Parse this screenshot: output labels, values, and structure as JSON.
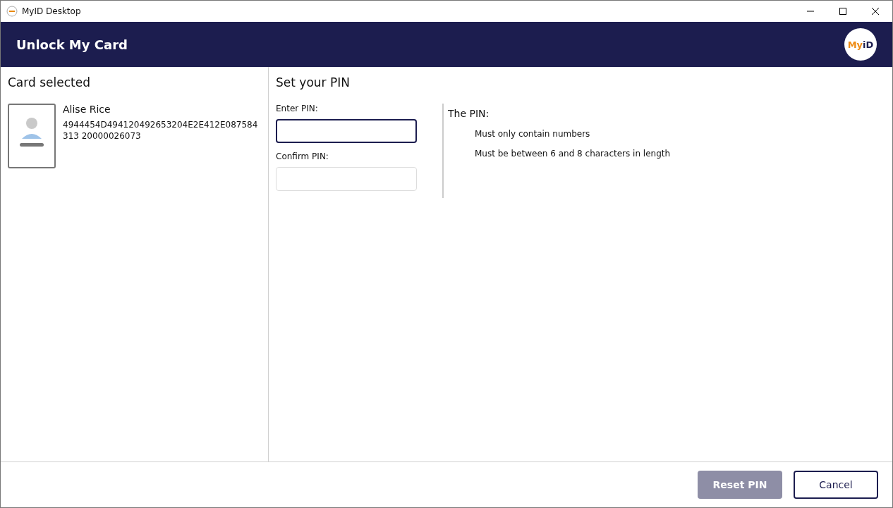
{
  "window": {
    "title": "MyID Desktop"
  },
  "header": {
    "title": "Unlock My Card",
    "logo": {
      "part_1": "My",
      "part_2": "iD"
    }
  },
  "card_panel": {
    "heading": "Card selected",
    "card": {
      "name": "Alise Rice",
      "serial": "4944454D494120492653204E2E412E087584313 20000026073"
    }
  },
  "pin_panel": {
    "heading": "Set your PIN",
    "fields": [
      {
        "label": "Enter PIN:",
        "focused": true
      },
      {
        "label": "Confirm PIN:",
        "focused": false
      }
    ],
    "rules": {
      "heading": "The PIN:",
      "items": [
        "Must only contain numbers",
        "Must be between 6 and 8 characters in length"
      ]
    }
  },
  "buttons": [
    {
      "label": "Reset PIN",
      "kind": "primary",
      "disabled": true
    },
    {
      "label": "Cancel",
      "kind": "secondary",
      "disabled": false
    }
  ]
}
